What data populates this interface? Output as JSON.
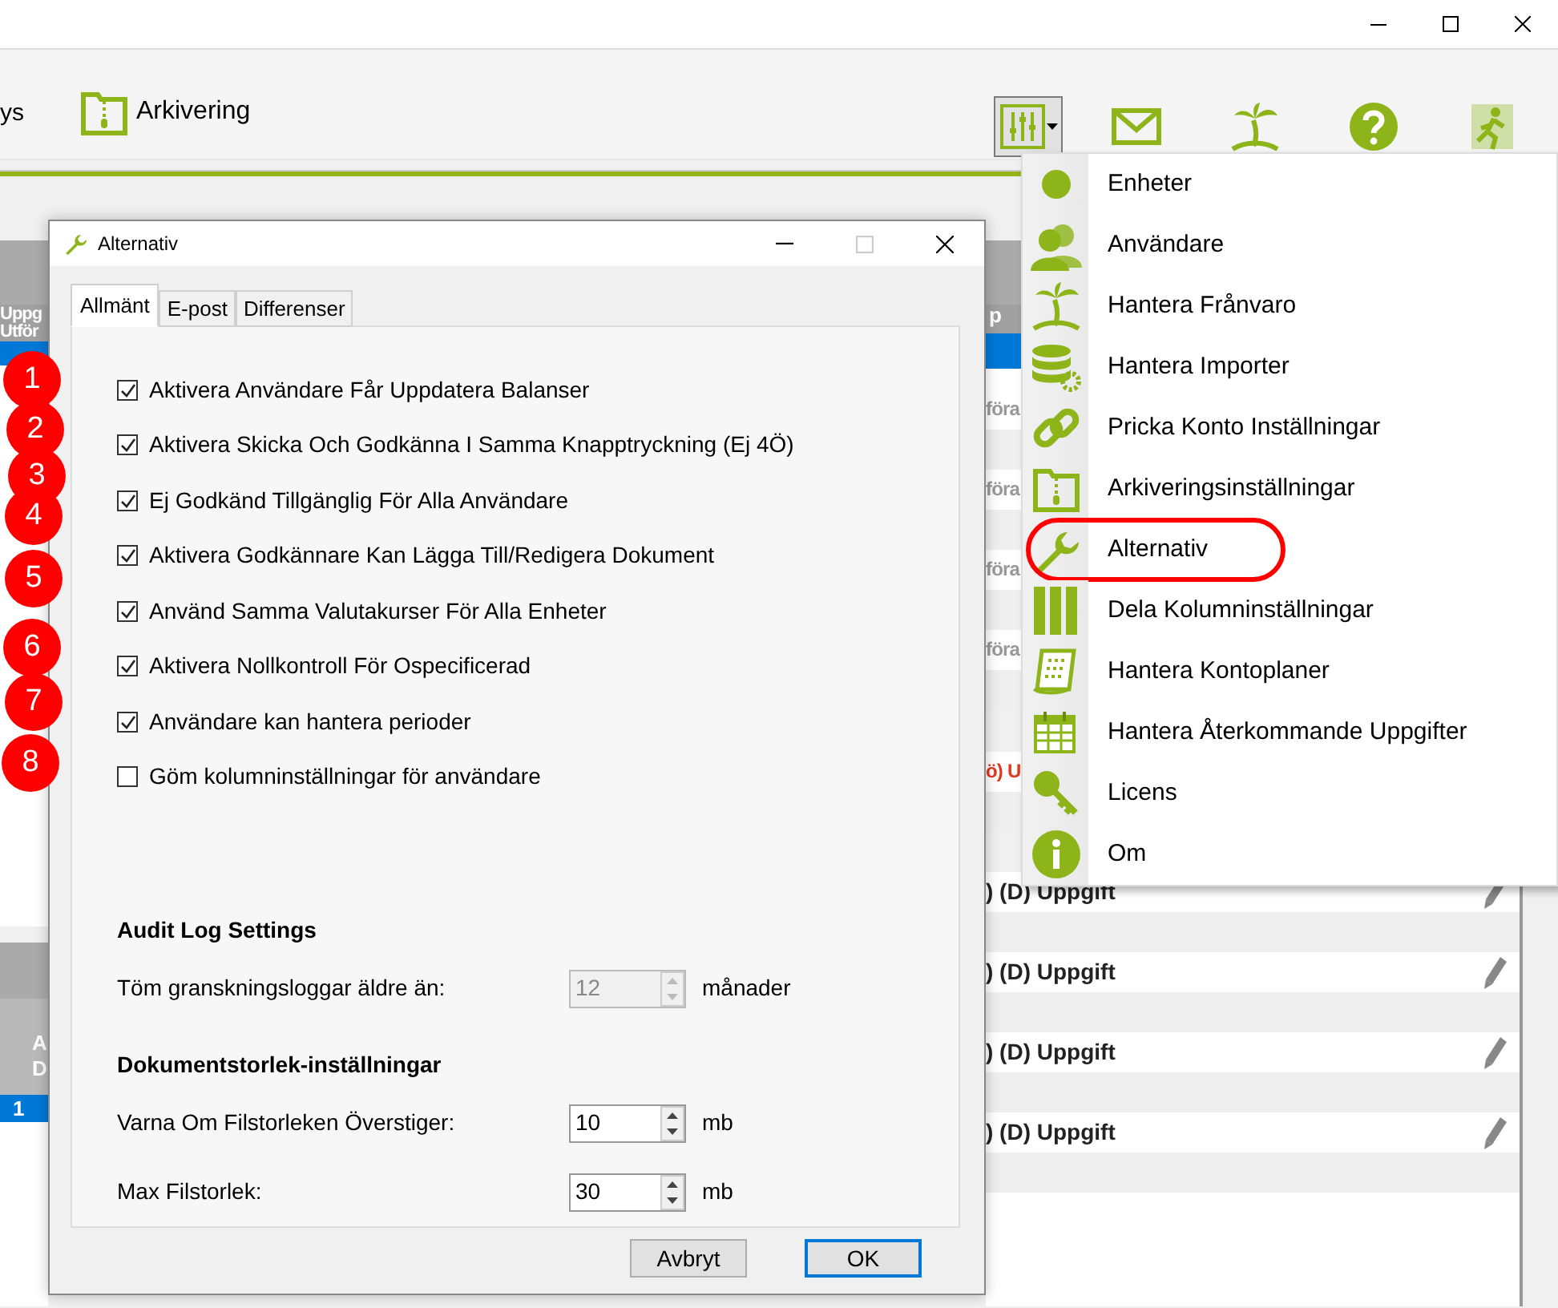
{
  "toolbar": {
    "cut_label": "ys",
    "archive_label": "Arkivering"
  },
  "left_panel": {
    "header_lines": [
      "Uppg",
      "Utför"
    ],
    "selected_row": true
  },
  "bottom_panel": {
    "header_lines": [
      "A",
      "D"
    ],
    "rows": [
      {
        "cell": "1",
        "selected": true
      }
    ]
  },
  "right_panel": {
    "header": "p",
    "selected_row": true,
    "rows": [
      {
        "text": "föra",
        "kind": "muted"
      },
      {
        "text": "föra",
        "kind": "muted"
      },
      {
        "text": "föra",
        "kind": "muted"
      },
      {
        "text": "föra",
        "kind": "muted"
      },
      {
        "text": "ö) U",
        "kind": "alert"
      },
      {
        "text": ") (D) Uppgift",
        "kind": "task"
      },
      {
        "text": ") (D) Uppgift",
        "kind": "task"
      },
      {
        "text": ") (D) Uppgift",
        "kind": "task"
      },
      {
        "text": ") (D) Uppgift",
        "kind": "task"
      }
    ]
  },
  "dialog": {
    "title": "Alternativ",
    "tabs": [
      {
        "label": "Allmänt",
        "selected": true
      },
      {
        "label": "E-post",
        "selected": false
      },
      {
        "label": "Differenser",
        "selected": false
      }
    ],
    "checkboxes": [
      {
        "label": "Aktivera Användare Får Uppdatera Balanser",
        "checked": true
      },
      {
        "label": "Aktivera Skicka Och Godkänna I Samma Knapptryckning (Ej 4Ö)",
        "checked": true
      },
      {
        "label": "Ej Godkänd Tillgänglig För Alla Användare",
        "checked": true
      },
      {
        "label": "Aktivera Godkännare Kan Lägga Till/Redigera Dokument",
        "checked": true
      },
      {
        "label": "Använd Samma Valutakurser För Alla Enheter",
        "checked": true
      },
      {
        "label": "Aktivera Nollkontroll För Ospecificerad",
        "checked": true
      },
      {
        "label": "Användare kan hantera perioder",
        "checked": true
      },
      {
        "label": "Göm kolumninställningar för användare",
        "checked": false
      }
    ],
    "sections": [
      {
        "heading": "Audit Log Settings",
        "fields": [
          {
            "label": "Töm granskningsloggar äldre än:",
            "value": "12",
            "unit": "månader",
            "disabled": true
          }
        ]
      },
      {
        "heading": "Dokumentstorlek-inställningar",
        "fields": [
          {
            "label": "Varna Om Filstorleken Överstiger:",
            "value": "10",
            "unit": "mb",
            "disabled": false
          },
          {
            "label": "Max Filstorlek:",
            "value": "30",
            "unit": "mb",
            "disabled": false
          }
        ]
      }
    ],
    "buttons": [
      {
        "label": "Avbryt",
        "default": false
      },
      {
        "label": "OK",
        "default": true
      }
    ]
  },
  "annotations": [
    "1",
    "2",
    "3",
    "4",
    "5",
    "6",
    "7",
    "8"
  ],
  "menu": {
    "items": [
      {
        "label": "Enheter",
        "circled": false
      },
      {
        "label": "Användare",
        "circled": false
      },
      {
        "label": "Hantera Frånvaro",
        "circled": false
      },
      {
        "label": "Hantera Importer",
        "circled": false
      },
      {
        "label": "Pricka Konto Inställningar",
        "circled": false
      },
      {
        "label": "Arkiveringsinställningar",
        "circled": false
      },
      {
        "label": "Alternativ",
        "circled": true
      },
      {
        "label": "Dela Kolumninställningar",
        "circled": false
      },
      {
        "label": "Hantera Kontoplaner",
        "circled": false
      },
      {
        "label": "Hantera Återkommande Uppgifter",
        "circled": false
      },
      {
        "label": "Licens",
        "circled": false
      },
      {
        "label": "Om",
        "circled": false
      }
    ]
  }
}
